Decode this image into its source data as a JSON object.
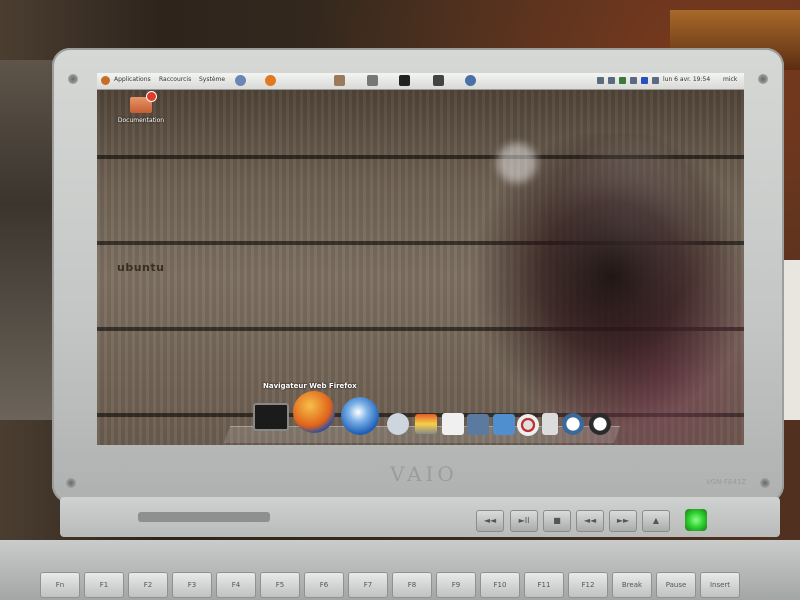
{
  "panel": {
    "menus": [
      "Applications",
      "Raccourcis",
      "Système"
    ],
    "clock": "lun 6 avr. 19:54",
    "user": "mick"
  },
  "desktop": {
    "icon_label": "Documentation",
    "wallpaper_brand": "ubuntu"
  },
  "dock": {
    "tooltip": "Navigateur Web Firefox",
    "items": [
      "terminal",
      "firefox",
      "thunderbird",
      "contacts",
      "monitor",
      "home",
      "system",
      "image-viewer",
      "network",
      "trash",
      "clock",
      "power"
    ]
  },
  "laptop": {
    "brand": "VAIO",
    "model": "VGN-FE41Z",
    "media_keys": [
      "◄◄",
      "►II",
      "■",
      "◄◄",
      "►►",
      "▲"
    ],
    "keys": [
      "Fn",
      "F1",
      "F2",
      "F3",
      "F4",
      "F5",
      "F6",
      "F7",
      "F8",
      "F9",
      "F10",
      "F11",
      "F12",
      "Break",
      "Pause",
      "Insert"
    ]
  },
  "colors": {
    "panel_bg": "#e6e6e3",
    "wood": "#6f6254",
    "power_led": "#2ccf2c",
    "folder": "#d6784b"
  }
}
